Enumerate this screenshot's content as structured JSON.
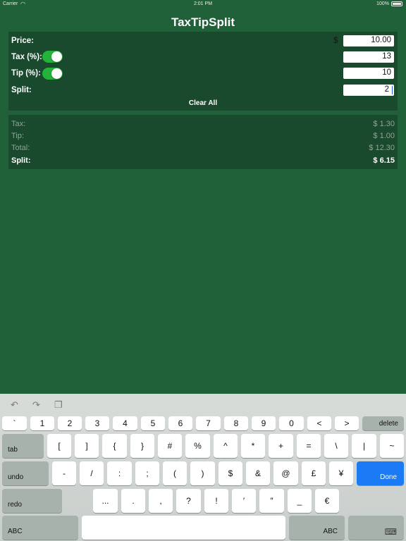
{
  "status_bar": {
    "carrier": "Carrier",
    "time": "2:01 PM",
    "battery": "100%"
  },
  "app": {
    "title": "TaxTipSplit"
  },
  "inputs": {
    "price_label": "Price:",
    "currency_symbol": "$",
    "price_value": "10.00",
    "tax_label": "Tax (%):",
    "tax_value": "13",
    "tax_enabled": true,
    "tip_label": "Tip (%):",
    "tip_value": "10",
    "tip_enabled": true,
    "split_label": "Split:",
    "split_value": "2",
    "clear_all": "Clear All"
  },
  "results": {
    "tax_label": "Tax:",
    "tax_value": "$ 1.30",
    "tip_label": "Tip:",
    "tip_value": "$ 1.00",
    "total_label": "Total:",
    "total_value": "$ 12.30",
    "split_label": "Split:",
    "split_value": "$ 6.15"
  },
  "keyboard": {
    "row1": [
      "`",
      "1",
      "2",
      "3",
      "4",
      "5",
      "6",
      "7",
      "8",
      "9",
      "0",
      "<",
      ">"
    ],
    "delete": "delete",
    "tab": "tab",
    "row2": [
      "[",
      "]",
      "{",
      "}",
      "#",
      "%",
      "^",
      "*",
      "+",
      "=",
      "\\",
      "|",
      "~"
    ],
    "undo": "undo",
    "row3": [
      "-",
      "/",
      ":",
      ";",
      "(",
      ")",
      "$",
      "&",
      "@",
      "£",
      "¥"
    ],
    "done": "Done",
    "redo": "redo",
    "row4": [
      "...",
      ".",
      ",",
      "?",
      "!",
      "′",
      "″",
      "_",
      "€"
    ],
    "abc_left": "ABC",
    "abc_right": "ABC"
  },
  "colors": {
    "background": "#20613a",
    "panel": "#1a4a2e",
    "toggle_on": "#23b33b",
    "done_key": "#1a7bf5"
  }
}
